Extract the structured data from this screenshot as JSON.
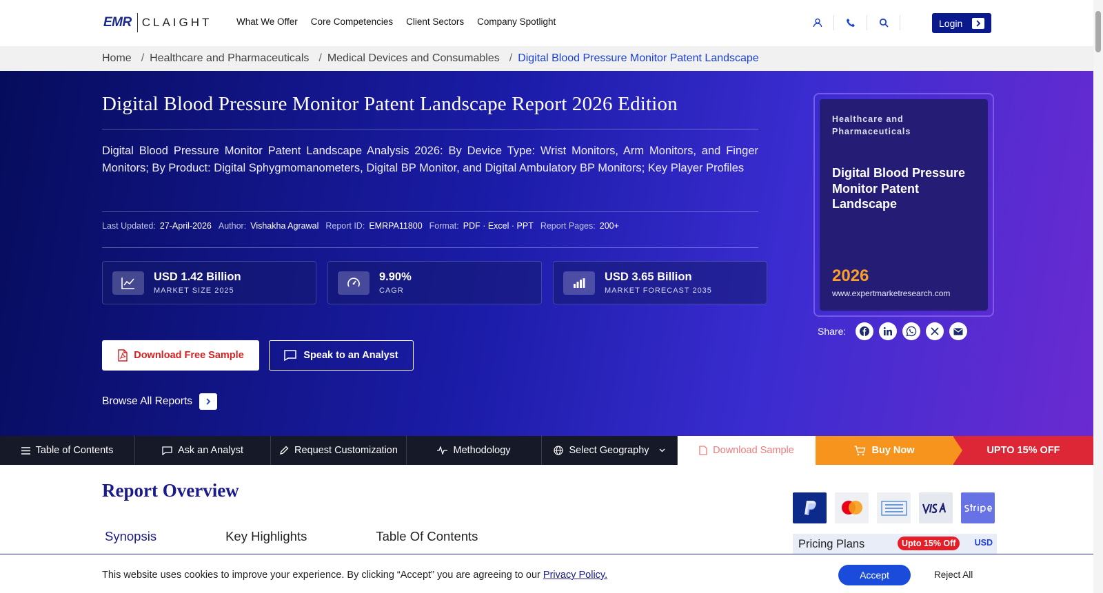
{
  "brand": {
    "emr": "EMR",
    "claight": "CLAIGHT"
  },
  "nav": [
    "What We Offer",
    "Core Competencies",
    "Client Sectors",
    "Company Spotlight"
  ],
  "header": {
    "login_label": "Login"
  },
  "breadcrumb": [
    "Home",
    "Healthcare and Pharmaceuticals",
    "Medical Devices and Consumables",
    "Digital Blood Pressure Monitor Patent Landscape"
  ],
  "hero": {
    "title": "Digital Blood Pressure Monitor Patent Landscape Report 2026 Edition",
    "description": "Digital Blood Pressure Monitor Patent Landscape Analysis 2026: By Device Type: Wrist Monitors, Arm Monitors, and Finger Monitors; By Product: Digital Sphygmomanometers, Digital BP Monitor, and Digital Ambulatory BP Monitors; Key Player Profiles",
    "meta": [
      {
        "key": "Last Updated:",
        "value": "27-April-2026"
      },
      {
        "key": "Author:",
        "value": "Vishakha Agrawal"
      },
      {
        "key": "Report ID:",
        "value": "EMRPA11800"
      },
      {
        "key": "Format:",
        "value": "PDF · Excel · PPT"
      },
      {
        "key": "Report Pages:",
        "value": "200+"
      }
    ],
    "stats": [
      {
        "value": "USD 1.42 Billion",
        "label": "MARKET SIZE 2025",
        "icon": "line-chart-icon"
      },
      {
        "value": "9.90%",
        "label": "CAGR",
        "icon": "gauge-icon"
      },
      {
        "value": "USD 3.65 Billion",
        "label": "MARKET FORECAST 2035",
        "icon": "bar-chart-icon"
      }
    ],
    "download_label": "Download Free Sample",
    "speak_label": "Speak to an Analyst",
    "browse_label": "Browse All Reports"
  },
  "cover": {
    "category": "Healthcare and Pharmaceuticals",
    "title": "Digital Blood Pressure Monitor Patent Landscape",
    "year": "2026",
    "url": "www.expertmarketresearch.com"
  },
  "share": {
    "label": "Share:",
    "icons": [
      "facebook-icon",
      "linkedin-icon",
      "whatsapp-icon",
      "x-icon",
      "email-icon"
    ]
  },
  "stickynav": {
    "toc": "Table of Contents",
    "ask": "Ask an Analyst",
    "custom": "Request Customization",
    "method": "Methodology",
    "geo": "Select Geography",
    "download": "Download Sample",
    "buy": "Buy Now",
    "offer": "UPTO 15% OFF"
  },
  "overview": {
    "title": "Report Overview",
    "tabs": [
      "Synopsis",
      "Key Highlights",
      "Table Of Contents"
    ]
  },
  "payments": [
    "paypal",
    "mastercard",
    "wire transfer",
    "VISA",
    "stripe"
  ],
  "pricing": {
    "label": "Pricing Plans",
    "badge": "Upto 15% Off",
    "currency": "USD"
  },
  "cookie": {
    "text": "This website uses cookies to improve your experience. By clicking “Accept” you are agreeing to our",
    "link": "Privacy Policy.",
    "accept": "Accept",
    "reject": "Reject All"
  },
  "colors": {
    "brand_navy": "#0a1a8c",
    "accent_orange": "#f7941d",
    "offer_red": "#dd2636",
    "download_red": "#d42020"
  }
}
